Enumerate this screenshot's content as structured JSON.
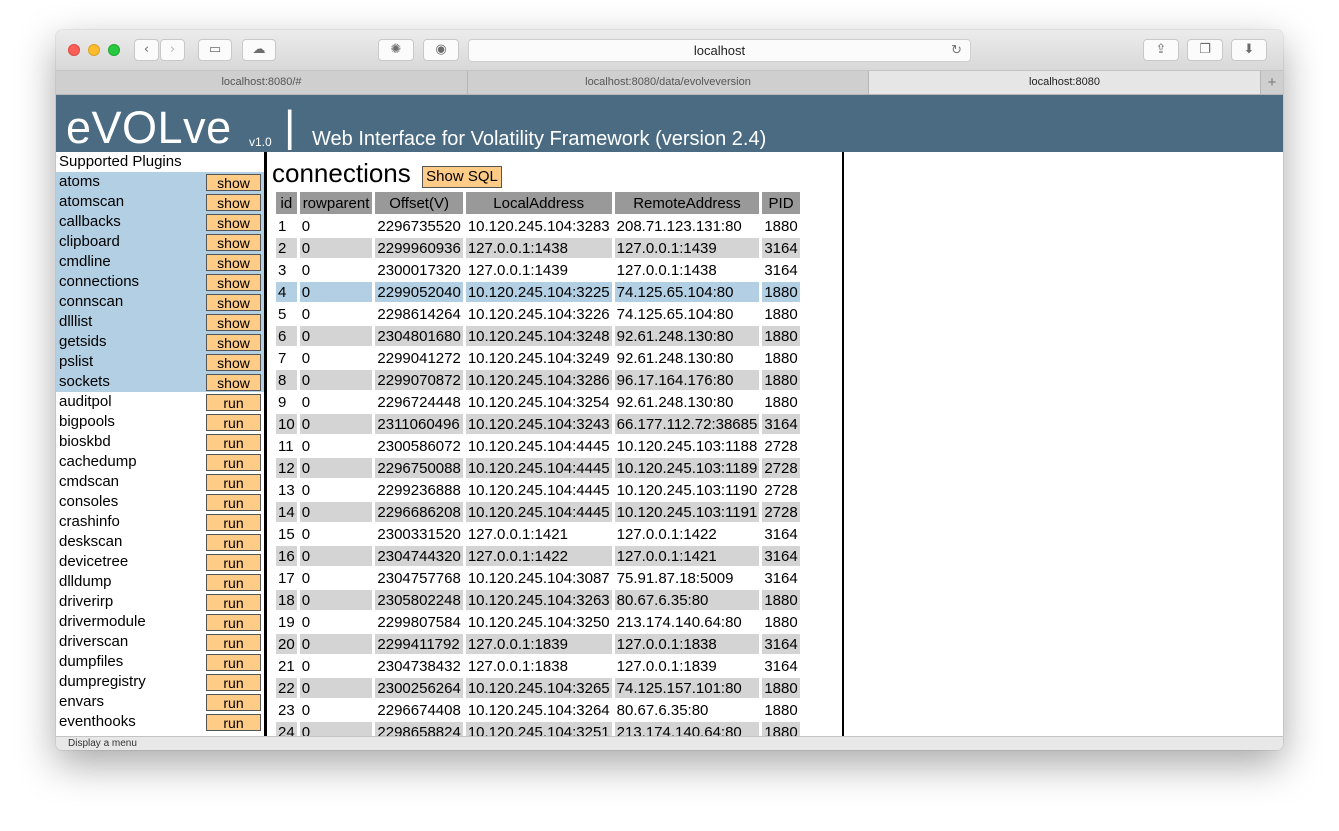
{
  "browser": {
    "url": "localhost",
    "tabs": [
      {
        "label": "localhost:8080/#"
      },
      {
        "label": "localhost:8080/data/evolveversion"
      },
      {
        "label": "localhost:8080"
      }
    ],
    "new_tab_label": "+",
    "status_text": "Display a menu"
  },
  "banner": {
    "brand": "eVOLve",
    "version": "v1.0",
    "separator": "|",
    "subtitle": "Web Interface for Volatility Framework (version 2.4)"
  },
  "sidebar": {
    "title": "Supported Plugins",
    "plugins": [
      {
        "name": "atoms",
        "action": "show"
      },
      {
        "name": "atomscan",
        "action": "show"
      },
      {
        "name": "callbacks",
        "action": "show"
      },
      {
        "name": "clipboard",
        "action": "show"
      },
      {
        "name": "cmdline",
        "action": "show"
      },
      {
        "name": "connections",
        "action": "show"
      },
      {
        "name": "connscan",
        "action": "show"
      },
      {
        "name": "dlllist",
        "action": "show"
      },
      {
        "name": "getsids",
        "action": "show"
      },
      {
        "name": "pslist",
        "action": "show"
      },
      {
        "name": "sockets",
        "action": "show"
      },
      {
        "name": "auditpol",
        "action": "run"
      },
      {
        "name": "bigpools",
        "action": "run"
      },
      {
        "name": "bioskbd",
        "action": "run"
      },
      {
        "name": "cachedump",
        "action": "run"
      },
      {
        "name": "cmdscan",
        "action": "run"
      },
      {
        "name": "consoles",
        "action": "run"
      },
      {
        "name": "crashinfo",
        "action": "run"
      },
      {
        "name": "deskscan",
        "action": "run"
      },
      {
        "name": "devicetree",
        "action": "run"
      },
      {
        "name": "dlldump",
        "action": "run"
      },
      {
        "name": "driverirp",
        "action": "run"
      },
      {
        "name": "drivermodule",
        "action": "run"
      },
      {
        "name": "driverscan",
        "action": "run"
      },
      {
        "name": "dumpfiles",
        "action": "run"
      },
      {
        "name": "dumpregistry",
        "action": "run"
      },
      {
        "name": "envars",
        "action": "run"
      },
      {
        "name": "eventhooks",
        "action": "run"
      }
    ]
  },
  "main": {
    "title": "connections",
    "show_sql_label": "Show SQL",
    "columns": [
      "id",
      "rowparent",
      "Offset(V)",
      "LocalAddress",
      "RemoteAddress",
      "PID"
    ],
    "rows": [
      [
        "1",
        "0",
        "2296735520",
        "10.120.245.104:3283",
        "208.71.123.131:80",
        "1880"
      ],
      [
        "2",
        "0",
        "2299960936",
        "127.0.0.1:1438",
        "127.0.0.1:1439",
        "3164"
      ],
      [
        "3",
        "0",
        "2300017320",
        "127.0.0.1:1439",
        "127.0.0.1:1438",
        "3164"
      ],
      [
        "4",
        "0",
        "2299052040",
        "10.120.245.104:3225",
        "74.125.65.104:80",
        "1880"
      ],
      [
        "5",
        "0",
        "2298614264",
        "10.120.245.104:3226",
        "74.125.65.104:80",
        "1880"
      ],
      [
        "6",
        "0",
        "2304801680",
        "10.120.245.104:3248",
        "92.61.248.130:80",
        "1880"
      ],
      [
        "7",
        "0",
        "2299041272",
        "10.120.245.104:3249",
        "92.61.248.130:80",
        "1880"
      ],
      [
        "8",
        "0",
        "2299070872",
        "10.120.245.104:3286",
        "96.17.164.176:80",
        "1880"
      ],
      [
        "9",
        "0",
        "2296724448",
        "10.120.245.104:3254",
        "92.61.248.130:80",
        "1880"
      ],
      [
        "10",
        "0",
        "2311060496",
        "10.120.245.104:3243",
        "66.177.112.72:38685",
        "3164"
      ],
      [
        "11",
        "0",
        "2300586072",
        "10.120.245.104:4445",
        "10.120.245.103:1188",
        "2728"
      ],
      [
        "12",
        "0",
        "2296750088",
        "10.120.245.104:4445",
        "10.120.245.103:1189",
        "2728"
      ],
      [
        "13",
        "0",
        "2299236888",
        "10.120.245.104:4445",
        "10.120.245.103:1190",
        "2728"
      ],
      [
        "14",
        "0",
        "2296686208",
        "10.120.245.104:4445",
        "10.120.245.103:1191",
        "2728"
      ],
      [
        "15",
        "0",
        "2300331520",
        "127.0.0.1:1421",
        "127.0.0.1:1422",
        "3164"
      ],
      [
        "16",
        "0",
        "2304744320",
        "127.0.0.1:1422",
        "127.0.0.1:1421",
        "3164"
      ],
      [
        "17",
        "0",
        "2304757768",
        "10.120.245.104:3087",
        "75.91.87.18:5009",
        "3164"
      ],
      [
        "18",
        "0",
        "2305802248",
        "10.120.245.104:3263",
        "80.67.6.35:80",
        "1880"
      ],
      [
        "19",
        "0",
        "2299807584",
        "10.120.245.104:3250",
        "213.174.140.64:80",
        "1880"
      ],
      [
        "20",
        "0",
        "2299411792",
        "127.0.0.1:1839",
        "127.0.0.1:1838",
        "3164"
      ],
      [
        "21",
        "0",
        "2304738432",
        "127.0.0.1:1838",
        "127.0.0.1:1839",
        "3164"
      ],
      [
        "22",
        "0",
        "2300256264",
        "10.120.245.104:3265",
        "74.125.157.101:80",
        "1880"
      ],
      [
        "23",
        "0",
        "2296674408",
        "10.120.245.104:3264",
        "80.67.6.35:80",
        "1880"
      ],
      [
        "24",
        "0",
        "2298658824",
        "10.120.245.104:3251",
        "213.174.140.64:80",
        "1880"
      ]
    ]
  }
}
